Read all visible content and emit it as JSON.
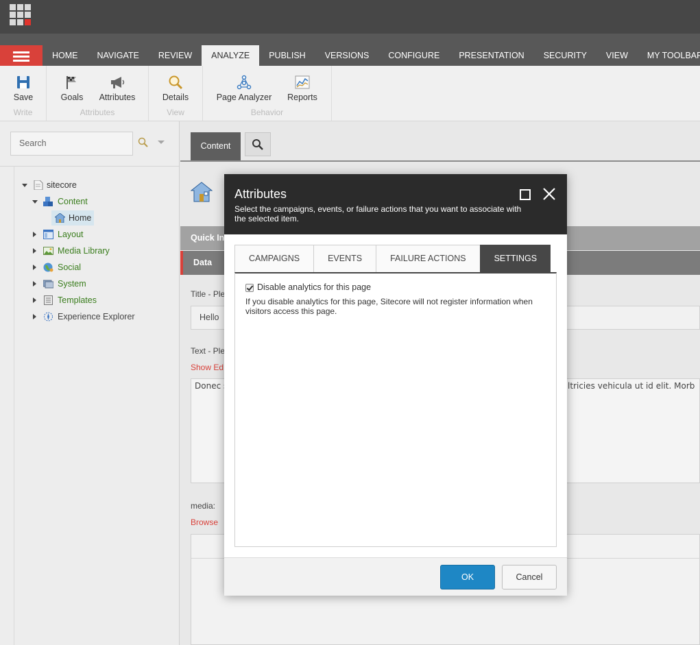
{
  "ribbon_tabs": [
    {
      "label": "HOME"
    },
    {
      "label": "NAVIGATE"
    },
    {
      "label": "REVIEW"
    },
    {
      "label": "ANALYZE"
    },
    {
      "label": "PUBLISH"
    },
    {
      "label": "VERSIONS"
    },
    {
      "label": "CONFIGURE"
    },
    {
      "label": "PRESENTATION"
    },
    {
      "label": "SECURITY"
    },
    {
      "label": "VIEW"
    },
    {
      "label": "MY TOOLBAR"
    }
  ],
  "active_tab": "ANALYZE",
  "ribbon": {
    "save": "Save",
    "write_group": "Write",
    "goals": "Goals",
    "attributes": "Attributes",
    "attributes_group": "Attributes",
    "details": "Details",
    "view_group": "View",
    "page_analyzer": "Page Analyzer",
    "reports": "Reports",
    "behavior_group": "Behavior"
  },
  "tree": {
    "search_placeholder": "Search",
    "root": "sitecore",
    "content": "Content",
    "home": "Home",
    "items": [
      "Layout",
      "Media Library",
      "Social",
      "System",
      "Templates",
      "Experience Explorer"
    ]
  },
  "editor": {
    "content_tab": "Content",
    "quick_info": "Quick In",
    "data_section": "Data",
    "title_label": "Title - Ple",
    "title_value": "Hello",
    "text_label": "Text - Ple",
    "show_editor": "Show Ed",
    "text_left": "Donec s",
    "text_right": "h ultricies vehicula ut id elit. Morb",
    "media_label": "media:",
    "browse": "Browse"
  },
  "dialog": {
    "title": "Attributes",
    "subtitle": "Select the campaigns, events, or failure actions that you want to associate with the selected item.",
    "tabs": [
      "CAMPAIGNS",
      "EVENTS",
      "FAILURE ACTIONS",
      "SETTINGS"
    ],
    "active_tab": "SETTINGS",
    "checkbox_label": "Disable analytics for this page",
    "checkbox_checked": true,
    "help_text": "If you disable analytics for this page, Sitecore will not register information when visitors access this page.",
    "ok": "OK",
    "cancel": "Cancel"
  },
  "colors": {
    "accent_red": "#d9413a",
    "primary_blue": "#1e87c5",
    "tree_green": "#3a7d1d"
  }
}
